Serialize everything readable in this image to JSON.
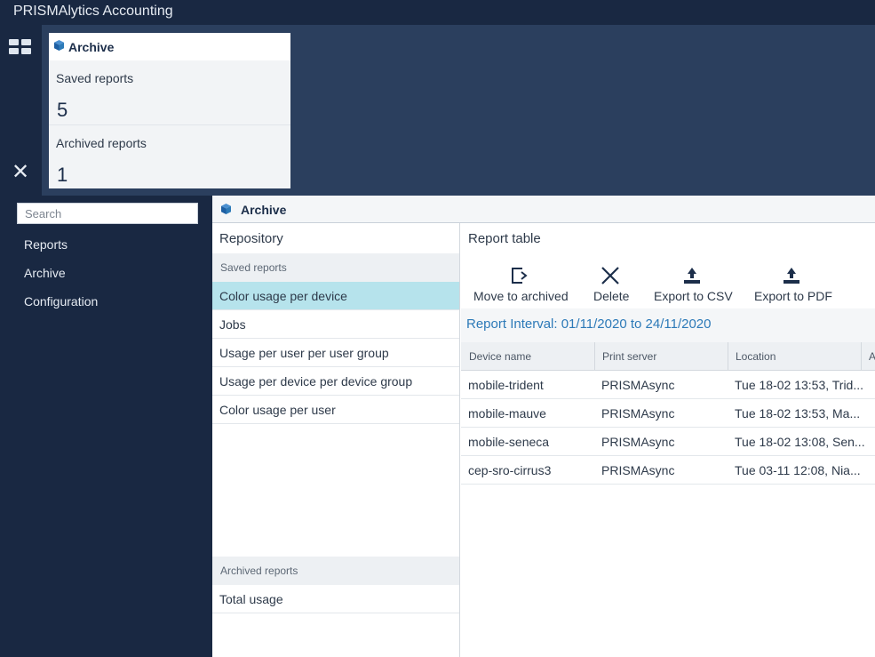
{
  "app": {
    "title": "PRISMAlytics Accounting"
  },
  "tile": {
    "title": "Archive",
    "saved_label": "Saved reports",
    "saved_count": "5",
    "archived_label": "Archived reports",
    "archived_count": "1"
  },
  "nav": {
    "search_placeholder": "Search",
    "items": [
      {
        "label": "Reports"
      },
      {
        "label": "Archive"
      },
      {
        "label": "Configuration"
      }
    ]
  },
  "main": {
    "title": "Archive"
  },
  "repository": {
    "title": "Repository",
    "saved_header": "Saved reports",
    "saved_items": [
      {
        "label": "Color usage per device",
        "selected": true
      },
      {
        "label": "Jobs"
      },
      {
        "label": "Usage per user per user group"
      },
      {
        "label": "Usage per device per device group"
      },
      {
        "label": "Color usage per user"
      }
    ],
    "archived_header": "Archived reports",
    "archived_items": [
      {
        "label": "Total usage"
      }
    ]
  },
  "report": {
    "title": "Report table",
    "toolbar": {
      "move_archived": "Move to archived",
      "delete": "Delete",
      "export_csv": "Export to CSV",
      "export_pdf": "Export to PDF"
    },
    "interval": "Report Interval: 01/11/2020 to 24/11/2020",
    "columns": [
      "Device name",
      "Print server",
      "Location",
      "A"
    ],
    "rows": [
      [
        "mobile-trident",
        "PRISMAsync",
        "Tue 18-02 13:53, Trid..."
      ],
      [
        "mobile-mauve",
        "PRISMAsync",
        "Tue 18-02 13:53, Ma..."
      ],
      [
        "mobile-seneca",
        "PRISMAsync",
        "Tue 18-02 13:08, Sen..."
      ],
      [
        "cep-sro-cirrus3",
        "PRISMAsync",
        "Tue 03-11 12:08, Nia..."
      ]
    ]
  },
  "colors": {
    "sidebar_bg": "#192842",
    "band_bg": "#2b3f5e",
    "selected_row": "#b6e3ec",
    "accent_blue": "#2d7ab8",
    "icon_navy": "#1c2e4a"
  },
  "icons": {
    "cube": "archive-cube-icon",
    "grid": "grid-icon",
    "close": "close-icon",
    "move": "move-to-archived-icon",
    "delete": "delete-icon",
    "export": "export-icon"
  }
}
